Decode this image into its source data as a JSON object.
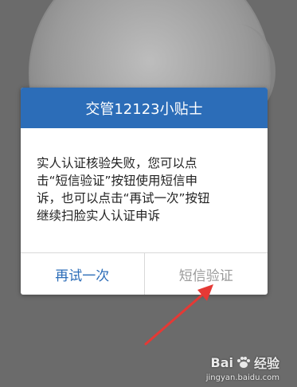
{
  "dialog": {
    "title": "交管12123小贴士",
    "message_lines": [
      "实人认证核验失败，您可以点",
      "击“短信验证”按钮使用短信申",
      "诉，也可以点击“再试一次”按钮",
      "继续扫脸实人认证申诉"
    ],
    "buttons": {
      "retry": "再试一次",
      "sms_verify": "短信验证"
    }
  },
  "watermark": {
    "brand_left": "Bai",
    "brand_right": "经验",
    "url": "jingyan.baidu.com"
  },
  "colors": {
    "header": "#2c6db8",
    "retry_text": "#2c6db8",
    "sms_text": "#9a9a9a",
    "annotation_arrow": "#e53935"
  }
}
